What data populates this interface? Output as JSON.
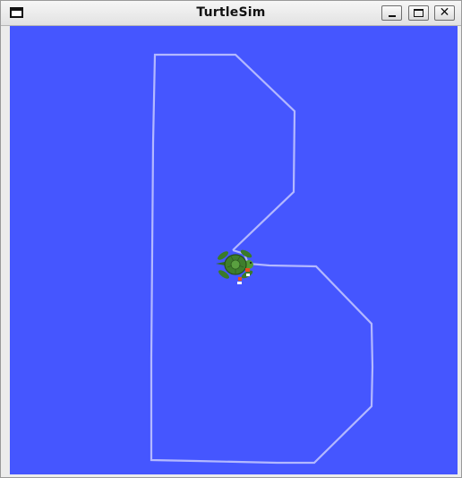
{
  "window": {
    "title": "TurtleSim",
    "window_icon": "window-menu-icon",
    "controls": {
      "minimize_icon": "minimize-icon",
      "maximize_icon": "maximize-icon",
      "close_icon": "close-icon",
      "close_glyph": "✕"
    }
  },
  "simulation": {
    "background_color": "#4556ff",
    "pen_color": "#b3b8ff",
    "turtle_count": 1,
    "trail_path_count": 1
  }
}
